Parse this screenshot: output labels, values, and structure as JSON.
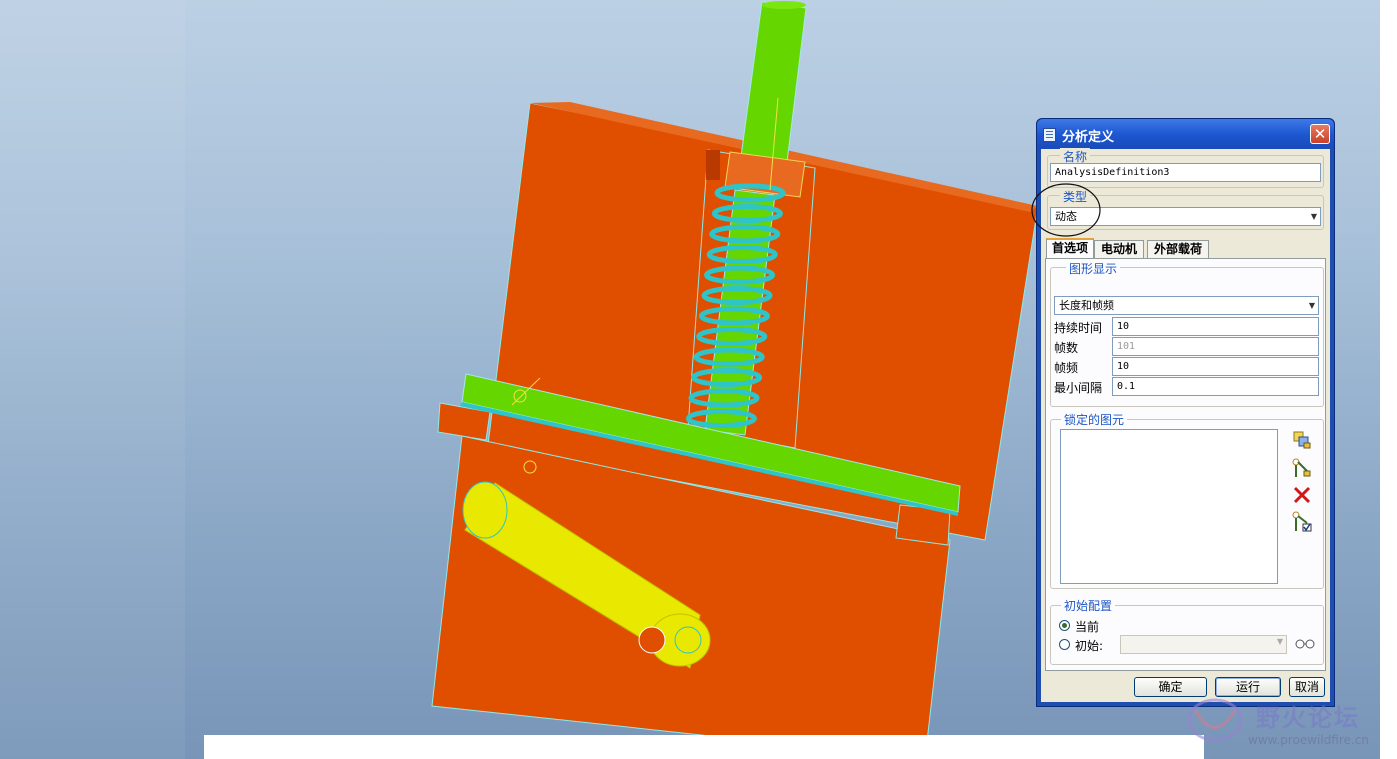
{
  "dialog": {
    "title": "分析定义",
    "close_glyph": "✕",
    "name_group": "名称",
    "name_value": "AnalysisDefinition3",
    "type_group": "类型",
    "type_value": "动态",
    "tabs": [
      "首选项",
      "电动机",
      "外部载荷"
    ],
    "graph_group": "图形显示",
    "graph_select": "长度和帧频",
    "rows": [
      {
        "label": "持续时间",
        "value": "10",
        "disabled": false
      },
      {
        "label": "帧数",
        "value": "101",
        "disabled": true
      },
      {
        "label": "帧频",
        "value": "10",
        "disabled": false
      },
      {
        "label": "最小间隔",
        "value": "0.1",
        "disabled": false
      }
    ],
    "locked_group": "锁定的图元",
    "init_group": "初始配置",
    "init_current": "当前",
    "init_snapshot": "初始:",
    "ok": "确定",
    "run": "运行",
    "cancel": "取消"
  },
  "watermark": {
    "text": "野火论坛",
    "url": "www.proewildfire.cn"
  },
  "colors": {
    "part_orange": "#e04e00",
    "spring_cyan": "#2ec4c8",
    "plunger_green": "#66d600",
    "arm_yellow": "#e8e800"
  }
}
